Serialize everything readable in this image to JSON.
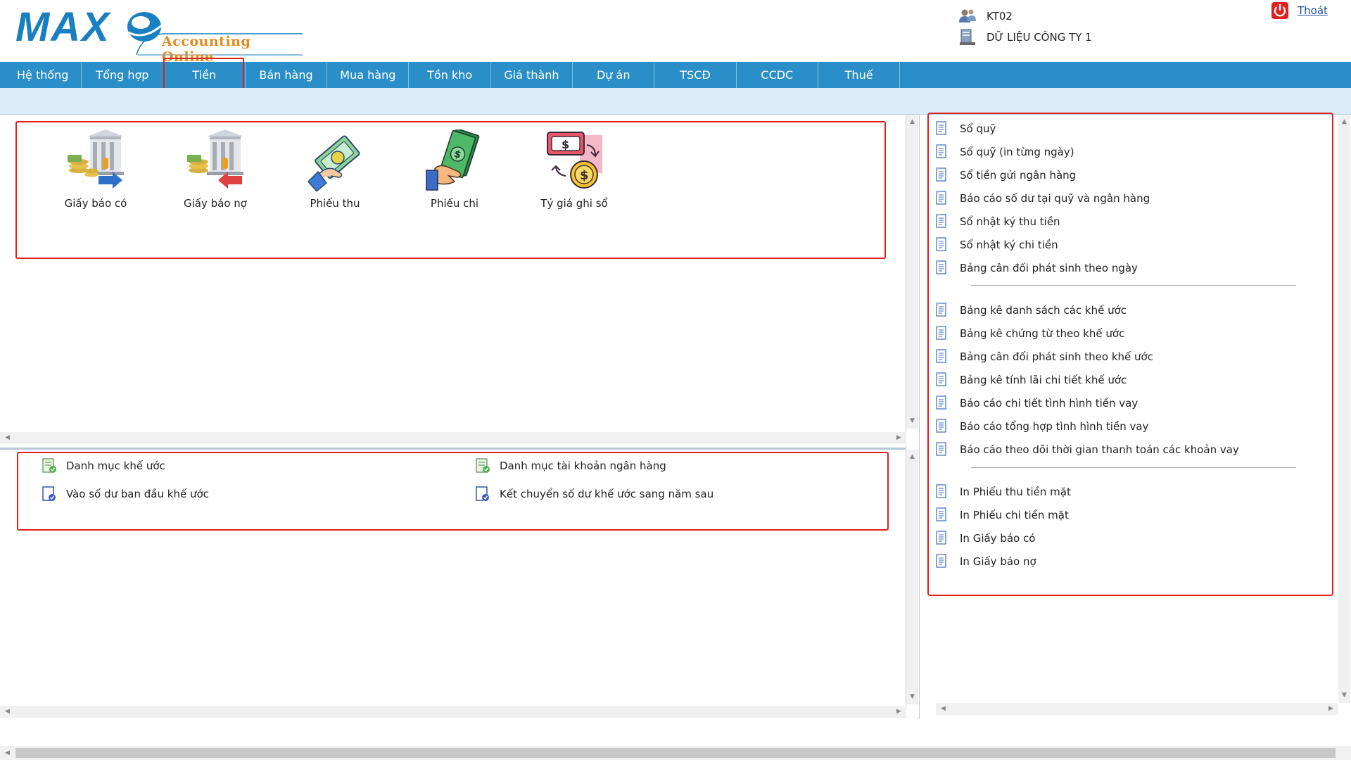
{
  "app": {
    "logo_text": "MAX",
    "logo_sub": "Accounting Online"
  },
  "user": {
    "code": "KT02",
    "database": "DỮ LIỆU CÔNG TY 1",
    "logout_label": "Thoát"
  },
  "nav": {
    "items": [
      "Hệ thống",
      "Tổng hợp",
      "Tiền",
      "Bán hàng",
      "Mua hàng",
      "Tồn kho",
      "Giá thành",
      "Dự án",
      "TSCĐ",
      "CCDC",
      "Thuế"
    ],
    "active_index": 2
  },
  "tiles": [
    {
      "label": "Giấy báo có",
      "icon": "bank-credit-icon"
    },
    {
      "label": "Giấy báo nợ",
      "icon": "bank-debit-icon"
    },
    {
      "label": "Phiếu thu",
      "icon": "cash-receipt-icon"
    },
    {
      "label": "Phiếu chi",
      "icon": "cash-payment-icon"
    },
    {
      "label": "Tỷ giá ghi sổ",
      "icon": "exchange-rate-icon"
    }
  ],
  "bottom_links": [
    {
      "label": "Danh mục khế ước",
      "icon": "catalog-icon"
    },
    {
      "label": "Danh mục tài khoản ngân hàng",
      "icon": "catalog-icon"
    },
    {
      "label": "Vào số dư ban đầu khế ước",
      "icon": "document-check-icon"
    },
    {
      "label": "Kết chuyển số dư khế ước sang năm sau",
      "icon": "document-check-icon"
    }
  ],
  "reports": {
    "group1": [
      "Sổ quỹ",
      "Sổ quỹ (in từng ngày)",
      "Sổ tiền gửi ngân hàng",
      "Báo cáo số dư tại quỹ và ngân hàng",
      "Sổ nhật ký thu tiền",
      "Sổ nhật ký chi tiền",
      "Bảng cân đối phát sinh theo ngày"
    ],
    "group2": [
      "Bảng kê danh sách các khế ước",
      "Bảng kê chứng từ theo khế ước",
      "Bảng cân đối phát sinh theo khế ước",
      "Bảng kê tính lãi chi tiết khế ước",
      "Báo cáo chi tiết tình hình tiền vay",
      "Báo cáo tổng hợp tình hình tiền vay",
      "Báo cáo theo dõi thời gian thanh toán các khoản vay"
    ],
    "group3": [
      "In Phiếu thu tiền mặt",
      "In Phiếu chi tiền mặt",
      "In Giấy báo có",
      "In Giấy báo nợ"
    ]
  },
  "colors": {
    "nav_bg": "#2a8fc8",
    "subbar_bg": "#dcebfa",
    "highlight": "#e0201e",
    "logo_blue": "#1a7fc1",
    "logo_orange": "#e38a1a"
  }
}
